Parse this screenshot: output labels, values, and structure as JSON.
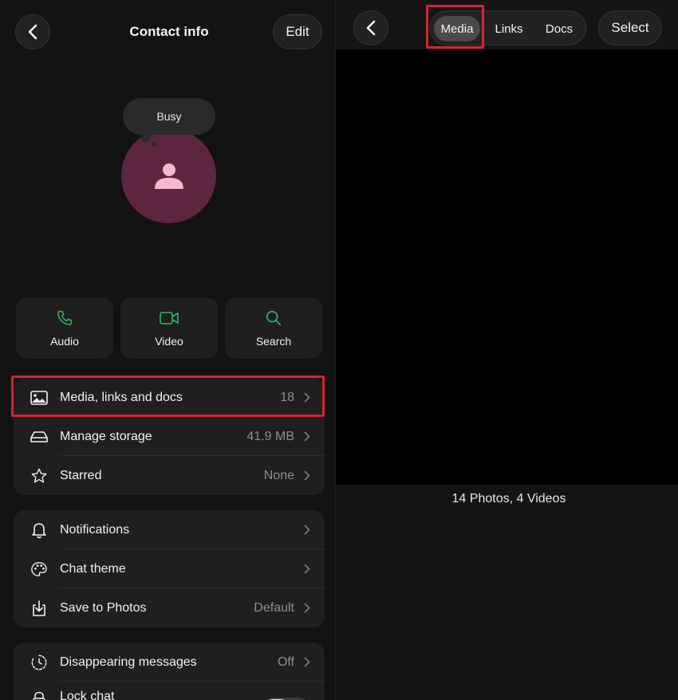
{
  "contact_panel": {
    "title": "Contact info",
    "edit_label": "Edit",
    "status": "Busy",
    "actions": [
      {
        "label": "Audio",
        "icon": "phone-icon"
      },
      {
        "label": "Video",
        "icon": "video-camera-icon"
      },
      {
        "label": "Search",
        "icon": "search-icon"
      }
    ],
    "group1": [
      {
        "label": "Media, links and docs",
        "value": "18",
        "icon": "image-icon"
      },
      {
        "label": "Manage storage",
        "value": "41.9 MB",
        "icon": "storage-drive-icon"
      },
      {
        "label": "Starred",
        "value": "None",
        "icon": "star-icon"
      }
    ],
    "group2": [
      {
        "label": "Notifications",
        "value": "",
        "icon": "bell-icon"
      },
      {
        "label": "Chat theme",
        "value": "",
        "icon": "palette-icon"
      },
      {
        "label": "Save to Photos",
        "value": "Default",
        "icon": "save-download-icon"
      }
    ],
    "group3": [
      {
        "label": "Disappearing messages",
        "value": "Off",
        "icon": "timer-icon"
      },
      {
        "label": "Lock chat",
        "icon": "lock-icon",
        "toggle_on": false
      }
    ]
  },
  "media_panel": {
    "tabs": [
      "Media",
      "Links",
      "Docs"
    ],
    "selected_tab": "Media",
    "select_label": "Select",
    "summary": "14 Photos, 4 Videos"
  },
  "colors": {
    "accent_green": "#2fb86a",
    "avatar_bg": "#5c2540",
    "avatar_figure": "#f6b8cf",
    "highlight_red": "#d6242f"
  }
}
